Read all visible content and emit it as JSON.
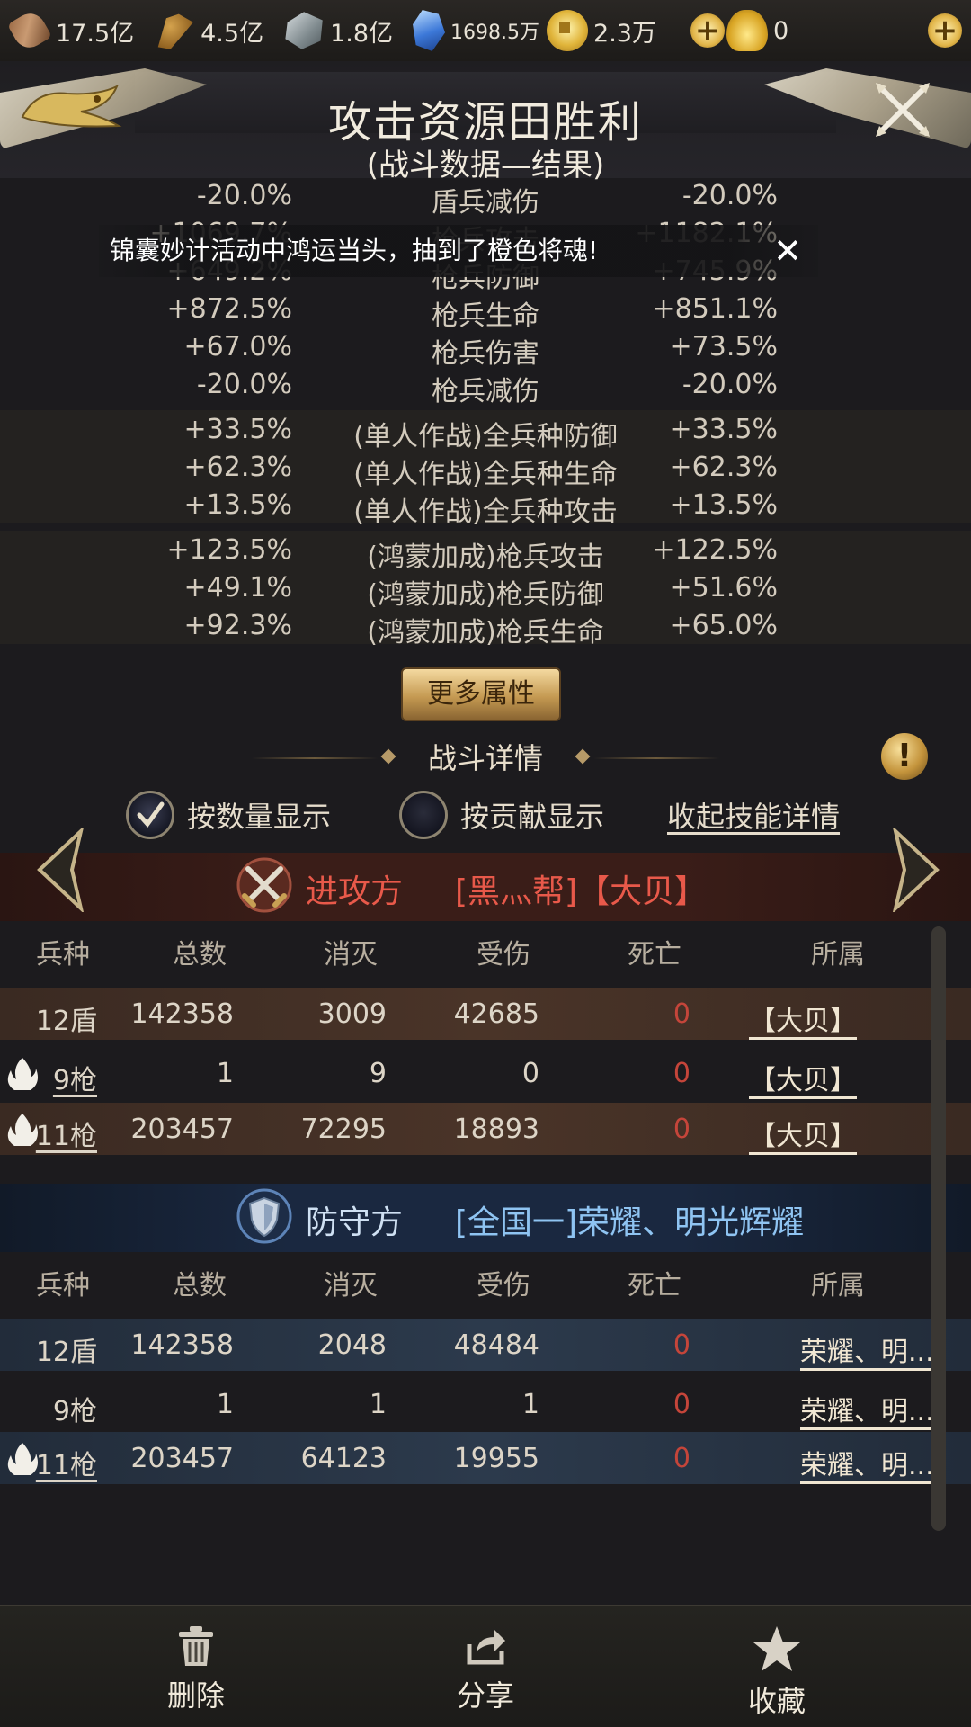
{
  "resources": [
    {
      "icon": "wood-icon",
      "value": "17.5亿"
    },
    {
      "icon": "grain-icon",
      "value": "4.5亿"
    },
    {
      "icon": "iron-icon",
      "value": "1.8亿"
    },
    {
      "icon": "gem-icon",
      "value": "1698.5万"
    },
    {
      "icon": "coin-icon",
      "value": "2.3万"
    },
    {
      "icon": "gold-icon",
      "value": "0"
    }
  ],
  "header": {
    "title": "攻击资源田胜利",
    "subtitle": "(战斗数据—结果)"
  },
  "toast": {
    "text": "锦囊妙计活动中鸿运当头，抽到了橙色将魂!",
    "close": "✕"
  },
  "stats": {
    "group1": [
      {
        "a": "-20.0%",
        "name": "盾兵减伤",
        "b": "-20.0%"
      },
      {
        "a": "+1069.7%",
        "name": "枪兵攻击",
        "b": "+1182.1%"
      },
      {
        "a": "+649.2%",
        "name": "枪兵防御",
        "b": "+745.9%"
      },
      {
        "a": "+872.5%",
        "name": "枪兵生命",
        "b": "+851.1%"
      },
      {
        "a": "+67.0%",
        "name": "枪兵伤害",
        "b": "+73.5%"
      },
      {
        "a": "-20.0%",
        "name": "枪兵减伤",
        "b": "-20.0%"
      }
    ],
    "group2": [
      {
        "a": "+33.5%",
        "name": "(单人作战)全兵种防御",
        "b": "+33.5%"
      },
      {
        "a": "+62.3%",
        "name": "(单人作战)全兵种生命",
        "b": "+62.3%"
      },
      {
        "a": "+13.5%",
        "name": "(单人作战)全兵种攻击",
        "b": "+13.5%"
      }
    ],
    "group3": [
      {
        "a": "+123.5%",
        "name": "(鸿蒙加成)枪兵攻击",
        "b": "+122.5%"
      },
      {
        "a": "+49.1%",
        "name": "(鸿蒙加成)枪兵防御",
        "b": "+51.6%"
      },
      {
        "a": "+92.3%",
        "name": "(鸿蒙加成)枪兵生命",
        "b": "+65.0%"
      }
    ]
  },
  "more_button": "更多属性",
  "battle_detail": {
    "title": "战斗详情",
    "info": "!",
    "option_by_count": "按数量显示",
    "option_by_contribution": "按贡献显示",
    "collapse_link": "收起技能详情"
  },
  "columns": [
    "兵种",
    "总数",
    "消灭",
    "受伤",
    "死亡",
    "所属"
  ],
  "attacker": {
    "side": "进攻方",
    "name": "[黑灬帮]【大贝】",
    "rows": [
      {
        "type": "12盾",
        "fire": false,
        "total": "142358",
        "kill": "3009",
        "hurt": "42685",
        "dead": "0",
        "owner": "【大贝】"
      },
      {
        "type": "9枪",
        "fire": true,
        "total": "1",
        "kill": "9",
        "hurt": "0",
        "dead": "0",
        "owner": "【大贝】"
      },
      {
        "type": "11枪",
        "fire": true,
        "total": "203457",
        "kill": "72295",
        "hurt": "18893",
        "dead": "0",
        "owner": "【大贝】"
      }
    ]
  },
  "defender": {
    "side": "防守方",
    "name": "[全国一]荣耀、明光辉耀",
    "rows": [
      {
        "type": "12盾",
        "fire": false,
        "total": "142358",
        "kill": "2048",
        "hurt": "48484",
        "dead": "0",
        "owner": "荣耀、明..."
      },
      {
        "type": "9枪",
        "fire": false,
        "total": "1",
        "kill": "1",
        "hurt": "1",
        "dead": "0",
        "owner": "荣耀、明..."
      },
      {
        "type": "11枪",
        "fire": true,
        "total": "203457",
        "kill": "64123",
        "hurt": "19955",
        "dead": "0",
        "owner": "荣耀、明..."
      }
    ]
  },
  "bottom": {
    "delete": "删除",
    "share": "分享",
    "favorite": "收藏"
  }
}
